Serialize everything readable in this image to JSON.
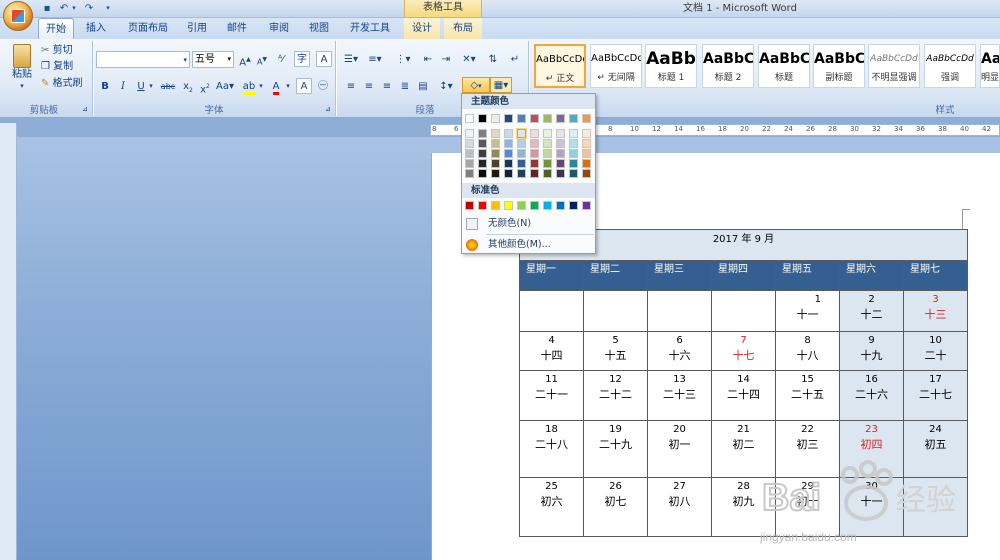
{
  "window": {
    "title": "文档 1 - Microsoft Word",
    "context_tab_group": "表格工具"
  },
  "tabs": [
    {
      "label": "开始",
      "active": true
    },
    {
      "label": "插入"
    },
    {
      "label": "页面布局"
    },
    {
      "label": "引用"
    },
    {
      "label": "邮件"
    },
    {
      "label": "审阅"
    },
    {
      "label": "视图"
    },
    {
      "label": "开发工具"
    },
    {
      "label": "设计"
    },
    {
      "label": "布局"
    }
  ],
  "ribbon": {
    "clipboard": {
      "paste": "粘贴",
      "cut": "剪切",
      "copy": "复制",
      "format_painter": "格式刷",
      "group_label": "剪贴板"
    },
    "font": {
      "font_name": "",
      "font_size": "五号",
      "group_label": "字体"
    },
    "paragraph": {
      "group_label": "段落"
    },
    "styles": {
      "group_label": "样式",
      "items": [
        {
          "sample": "AaBbCcDd",
          "name": "↵ 正文"
        },
        {
          "sample": "AaBbCcDd",
          "name": "↵ 无间隔"
        },
        {
          "sample": "AaBb",
          "name": "标题 1"
        },
        {
          "sample": "AaBbC",
          "name": "标题 2"
        },
        {
          "sample": "AaBbC",
          "name": "标题"
        },
        {
          "sample": "AaBbC",
          "name": "副标题"
        },
        {
          "sample": "AaBbCcDd",
          "name": "不明显强调"
        },
        {
          "sample": "AaBbCcDd",
          "name": "强调"
        },
        {
          "sample": "AaBbC",
          "name": "明显"
        }
      ]
    }
  },
  "color_dropdown": {
    "theme_colors_label": "主题颜色",
    "standard_colors_label": "标准色",
    "no_color": "无颜色(N)",
    "more_colors": "其他颜色(M)...",
    "theme_top": [
      "#ffffff",
      "#000000",
      "#eeece1",
      "#1f497d",
      "#4f81bd",
      "#c0504d",
      "#9bbb59",
      "#8064a2",
      "#4bacc6",
      "#f79646"
    ],
    "theme_shades": [
      [
        "#f2f2f2",
        "#7f7f7f",
        "#ddd9c3",
        "#c6d9f0",
        "#dbe5f1",
        "#f2dcdb",
        "#ebf1dd",
        "#e5e0ec",
        "#dbeef3",
        "#fdeada"
      ],
      [
        "#d8d8d8",
        "#595959",
        "#c4bd97",
        "#8db3e2",
        "#b8cce4",
        "#e5b9b7",
        "#d7e3bc",
        "#ccc1d9",
        "#b7dde8",
        "#fbd5b5"
      ],
      [
        "#bfbfbf",
        "#3f3f3f",
        "#938953",
        "#548dd4",
        "#95b3d7",
        "#d99694",
        "#c3d69b",
        "#b2a2c7",
        "#92cddc",
        "#fac08f"
      ],
      [
        "#a5a5a5",
        "#262626",
        "#494429",
        "#17365d",
        "#366092",
        "#953734",
        "#76923c",
        "#5f497a",
        "#31859b",
        "#e36c09"
      ],
      [
        "#7f7f7f",
        "#0c0c0c",
        "#1d1b10",
        "#0f243e",
        "#244061",
        "#632423",
        "#4f6128",
        "#3f3151",
        "#205867",
        "#974806"
      ]
    ],
    "standard": [
      "#c00000",
      "#ff0000",
      "#ffc000",
      "#ffff00",
      "#92d050",
      "#00b050",
      "#00b0f0",
      "#0070c0",
      "#002060",
      "#7030a0"
    ]
  },
  "ruler": {
    "ticks": [
      "8",
      "6",
      "4",
      "2",
      "",
      "2",
      "4",
      "6",
      "8",
      "10",
      "12",
      "14",
      "16",
      "18",
      "20",
      "22",
      "24",
      "26",
      "28",
      "30",
      "32",
      "34",
      "36",
      "38",
      "40",
      "42"
    ]
  },
  "calendar": {
    "title": "2017 年 9 月",
    "weekdays": [
      "星期一",
      "星期二",
      "星期三",
      "星期四",
      "星期五",
      "星期六",
      "星期七"
    ],
    "weeks": [
      [
        {
          "d": "",
          "l": ""
        },
        {
          "d": "",
          "l": ""
        },
        {
          "d": "",
          "l": ""
        },
        {
          "d": "",
          "l": ""
        },
        {
          "d": "1",
          "l": "十一"
        },
        {
          "d": "2",
          "l": "十二"
        },
        {
          "d": "3",
          "l": "十三",
          "red": true
        }
      ],
      [
        {
          "d": "4",
          "l": "十四"
        },
        {
          "d": "5",
          "l": "十五"
        },
        {
          "d": "6",
          "l": "十六"
        },
        {
          "d": "7",
          "l": "十七",
          "red": true
        },
        {
          "d": "8",
          "l": "十八"
        },
        {
          "d": "9",
          "l": "十九"
        },
        {
          "d": "10",
          "l": "二十"
        }
      ],
      [
        {
          "d": "11",
          "l": "二十一"
        },
        {
          "d": "12",
          "l": "二十二"
        },
        {
          "d": "13",
          "l": "二十三"
        },
        {
          "d": "14",
          "l": "二十四"
        },
        {
          "d": "15",
          "l": "二十五"
        },
        {
          "d": "16",
          "l": "二十六"
        },
        {
          "d": "17",
          "l": "二十七"
        }
      ],
      [
        {
          "d": "18",
          "l": "二十八"
        },
        {
          "d": "19",
          "l": "二十九"
        },
        {
          "d": "20",
          "l": "初一"
        },
        {
          "d": "21",
          "l": "初二"
        },
        {
          "d": "22",
          "l": "初三"
        },
        {
          "d": "23",
          "l": "初四",
          "red": true
        },
        {
          "d": "24",
          "l": "初五"
        }
      ],
      [
        {
          "d": "25",
          "l": "初六"
        },
        {
          "d": "26",
          "l": "初七"
        },
        {
          "d": "27",
          "l": "初八"
        },
        {
          "d": "28",
          "l": "初九"
        },
        {
          "d": "29",
          "l": "初十"
        },
        {
          "d": "30",
          "l": "十一"
        },
        {
          "d": "",
          "l": ""
        }
      ]
    ]
  },
  "watermark": {
    "brand": "Bai",
    "brand2": "经验",
    "url": "jingyan.baidu.com"
  }
}
